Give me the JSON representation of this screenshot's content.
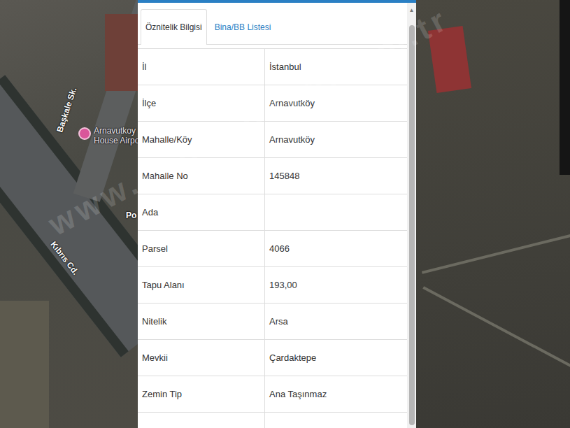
{
  "map": {
    "street_labels": [
      {
        "text": "Başkale Sk."
      },
      {
        "text": "Kıbrıs Cd."
      },
      {
        "text": "Po"
      }
    ],
    "poi": {
      "lines": [
        "Arnavutkoy",
        "House Airpo"
      ]
    },
    "watermark": "www.sahibinden.com.tr"
  },
  "panel": {
    "tabs": [
      {
        "label": "Öznitelik Bilgisi",
        "selected": true
      },
      {
        "label": "Bina/BB Listesi",
        "selected": false
      }
    ],
    "rows": [
      {
        "label": "İl",
        "value": "İstanbul"
      },
      {
        "label": "İlçe",
        "value": "Arnavutköy"
      },
      {
        "label": "Mahalle/Köy",
        "value": "Arnavutköy"
      },
      {
        "label": "Mahalle No",
        "value": "145848"
      },
      {
        "label": "Ada",
        "value": ""
      },
      {
        "label": "Parsel",
        "value": "4066"
      },
      {
        "label": "Tapu Alanı",
        "value": "193,00"
      },
      {
        "label": "Nitelik",
        "value": "Arsa"
      },
      {
        "label": "Mevkii",
        "value": "Çardaktepe"
      },
      {
        "label": "Zemin Tip",
        "value": "Ana Taşınmaz"
      },
      {
        "label": "",
        "value": ""
      }
    ],
    "scrollbar": {
      "arrow": "▲"
    }
  }
}
